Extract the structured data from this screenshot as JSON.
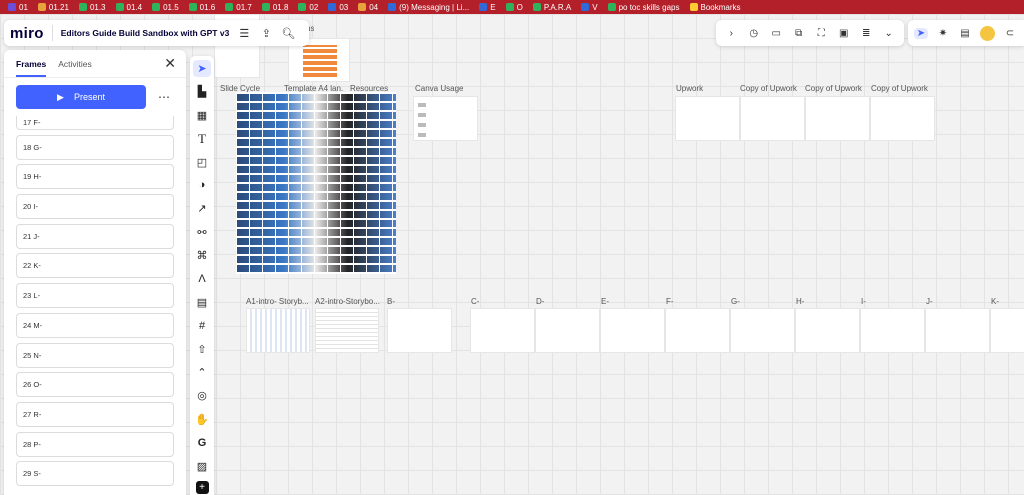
{
  "bookmarks": [
    {
      "label": "01",
      "color": "#6b4fd8"
    },
    {
      "label": "01.21",
      "color": "#e8a23a"
    },
    {
      "label": "01.3",
      "color": "#2fb35a"
    },
    {
      "label": "01.4",
      "color": "#2fb35a"
    },
    {
      "label": "01.5",
      "color": "#2fb35a"
    },
    {
      "label": "01.6",
      "color": "#2fb35a"
    },
    {
      "label": "01.7",
      "color": "#2fb35a"
    },
    {
      "label": "01.8",
      "color": "#2fb35a"
    },
    {
      "label": "02",
      "color": "#2fb35a"
    },
    {
      "label": "03",
      "color": "#2f6ad8"
    },
    {
      "label": "04",
      "color": "#e8a23a"
    },
    {
      "label": "(9) Messaging | Li...",
      "color": "#2f6ad8"
    },
    {
      "label": "E",
      "color": "#2f6ad8"
    },
    {
      "label": "O",
      "color": "#2fb35a"
    },
    {
      "label": "P.A.R.A",
      "color": "#2fb35a"
    },
    {
      "label": "V",
      "color": "#2f6ad8"
    },
    {
      "label": "po toc skills gaps",
      "color": "#2fb35a"
    },
    {
      "label": "Bookmarks",
      "color": "#ffcc33"
    }
  ],
  "topbar": {
    "logo": "miro",
    "title": "Editors Guide Build Sandbox with GPT v3"
  },
  "panel": {
    "tabs": [
      "Frames",
      "Activities"
    ],
    "present": "Present",
    "frames": [
      "17 F-",
      "18 G-",
      "19 H-",
      "20 I-",
      "21 J-",
      "22 K-",
      "23 L-",
      "24 M-",
      "25 N-",
      "26 O-",
      "27 R-",
      "28 P-",
      "29 S-"
    ]
  },
  "canvas": {
    "labels": {
      "slide": "Slide Cycle",
      "template": "Template A4 lan...",
      "resources": "Resources",
      "canva": "Canva Usage",
      "upwork": "Upwork",
      "copy1": "Copy of Upwork",
      "copy2": "Copy of Upwork",
      "copy3": "Copy of Upwork",
      "a1": "A1-intro- Storyb...",
      "a2": "A2-intro-Storybo...",
      "b": "B-",
      "c": "C-",
      "d": "D-",
      "e": "E-",
      "f": "F-",
      "g": "G-",
      "h": "H-",
      "i": "I-",
      "j": "J-",
      "k": "K-",
      "top": "ns"
    }
  },
  "colors": {
    "accent": "#4262ff",
    "bookmark_bar": "#b3202a",
    "orange": "#f08a3c"
  }
}
